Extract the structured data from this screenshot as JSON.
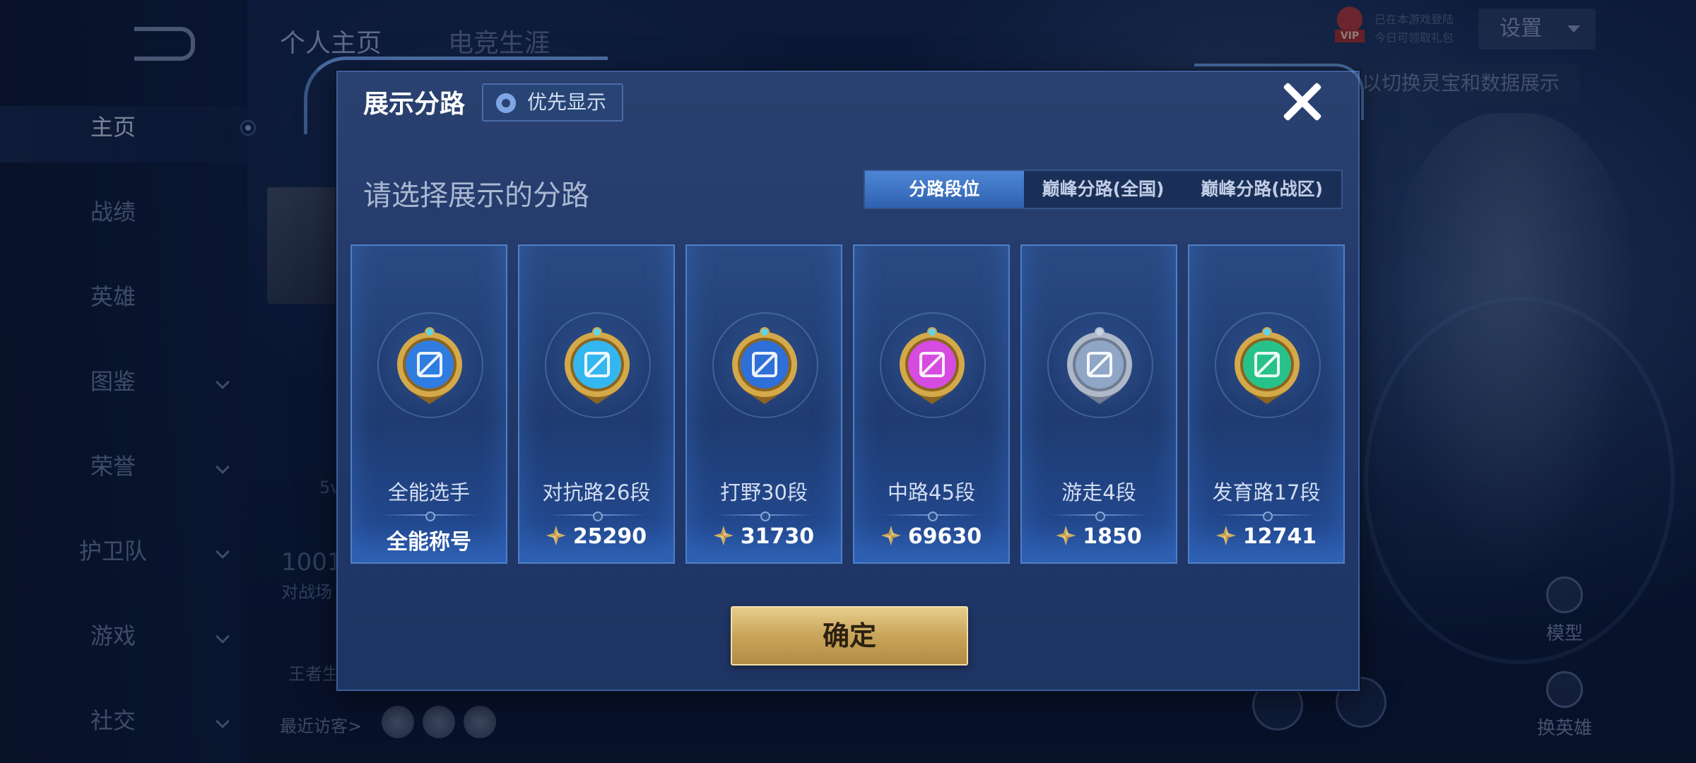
{
  "nav": {
    "items": [
      {
        "label": "主页",
        "active": true,
        "has_chevron": false
      },
      {
        "label": "战绩",
        "has_chevron": false
      },
      {
        "label": "英雄",
        "has_chevron": false
      },
      {
        "label": "图鉴",
        "has_chevron": true
      },
      {
        "label": "荣誉",
        "has_chevron": true
      },
      {
        "label": "护卫队",
        "has_chevron": true
      },
      {
        "label": "游戏",
        "has_chevron": true
      },
      {
        "label": "社交",
        "has_chevron": true
      }
    ]
  },
  "header": {
    "tabs": [
      "个人主页",
      "电竞生涯"
    ],
    "vip_badge": "VIP",
    "vip_line1": "已在本游戏登陆",
    "vip_line2": "今日可领取礼包",
    "settings_label": "设置",
    "hint": "以切换灵宝和数据展示"
  },
  "background": {
    "partial_texts": {
      "num_1001": "1001",
      "battle_text": "对战场",
      "five_text": "5v",
      "king_text": "王者生",
      "recent_visitors": "最近访客>",
      "model": "模型",
      "switch_hero": "换英雄"
    }
  },
  "modal": {
    "title": "展示分路",
    "priority_button": "优先显示",
    "subtitle": "请选择展示的分路",
    "tabs": [
      "分路段位",
      "巅峰分路(全国)",
      "巅峰分路(战区)"
    ],
    "active_tab": 0,
    "cards": [
      {
        "label": "全能选手",
        "value": "全能称号",
        "show_score_icon": false,
        "badge": "all-round-badge-icon",
        "color": "#2f7de0"
      },
      {
        "label": "对抗路26段",
        "value": "25290",
        "show_score_icon": true,
        "badge": "clash-lane-badge-icon",
        "color": "#34b7f0"
      },
      {
        "label": "打野30段",
        "value": "31730",
        "show_score_icon": true,
        "badge": "jungle-badge-icon",
        "color": "#2e6fd8"
      },
      {
        "label": "中路45段",
        "value": "69630",
        "show_score_icon": true,
        "badge": "mid-lane-badge-icon",
        "color": "#d64be0"
      },
      {
        "label": "游走4段",
        "value": "1850",
        "show_score_icon": true,
        "badge": "roam-badge-icon",
        "color": "#8fa6c6"
      },
      {
        "label": "发育路17段",
        "value": "12741",
        "show_score_icon": true,
        "badge": "farm-lane-badge-icon",
        "color": "#27c28a"
      }
    ],
    "confirm_button": "确定"
  }
}
